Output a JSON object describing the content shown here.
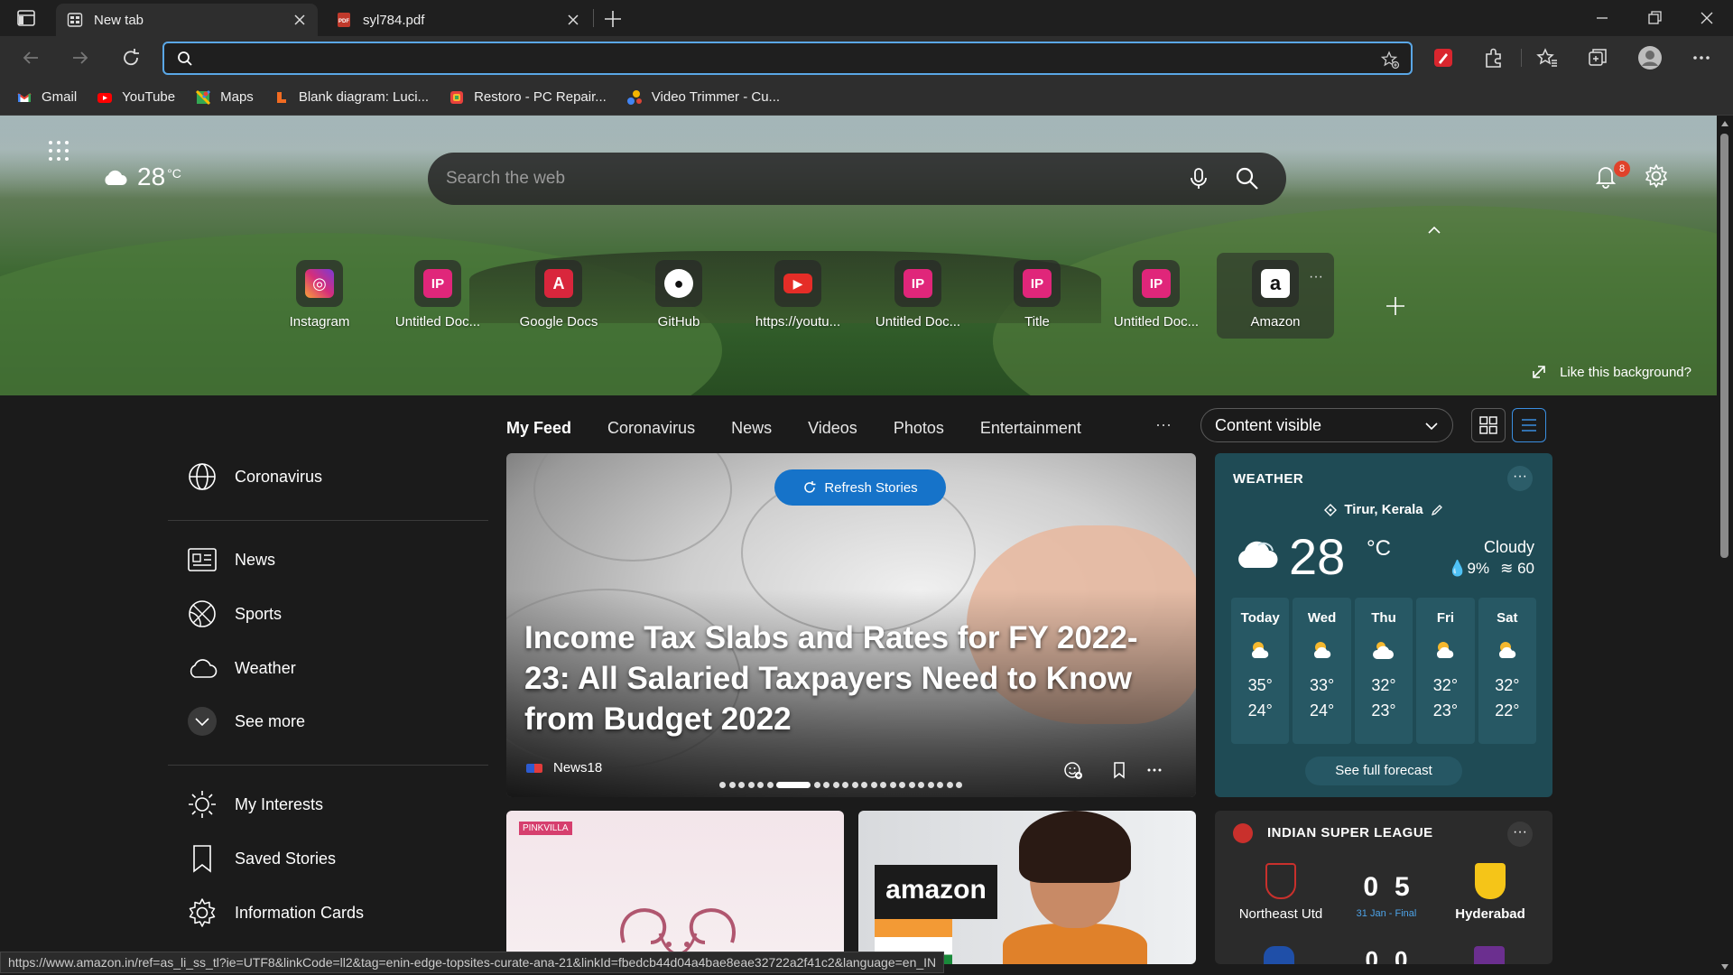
{
  "browser": {
    "tabs": [
      {
        "title": "New tab",
        "active": true
      },
      {
        "title": "syl784.pdf",
        "active": false
      }
    ],
    "address": {
      "value": "",
      "placeholder": ""
    },
    "bookmarks": [
      {
        "label": "Gmail",
        "icon": "gmail-icon"
      },
      {
        "label": "YouTube",
        "icon": "youtube-icon"
      },
      {
        "label": "Maps",
        "icon": "maps-icon"
      },
      {
        "label": "Blank diagram: Luci...",
        "icon": "lucidchart-icon"
      },
      {
        "label": "Restoro - PC Repair...",
        "icon": "restoro-icon"
      },
      {
        "label": "Video Trimmer - Cu...",
        "icon": "video-trimmer-icon"
      }
    ],
    "status_url": "https://www.amazon.in/ref=as_li_ss_tl?ie=UTF8&linkCode=ll2&tag=enin-edge-topsites-curate-ana-21&linkId=fbedcb44d04a4bae8eae32722a2f41c2&language=en_IN"
  },
  "hero": {
    "weather_temp": "28",
    "weather_unit": "°C",
    "search_placeholder": "Search the web",
    "notification_count": "8",
    "like_background": "Like this background?",
    "quick_links": [
      {
        "label": "Instagram",
        "glyph": "◎",
        "color": "#d62e7a"
      },
      {
        "label": "Untitled Doc...",
        "glyph": "IP",
        "color": "#e0267a"
      },
      {
        "label": "Google Docs",
        "glyph": "A",
        "color": "#d9263c"
      },
      {
        "label": "GitHub",
        "glyph": "●",
        "color": "#111111"
      },
      {
        "label": "https://youtu...",
        "glyph": "▶",
        "color": "#e52d27"
      },
      {
        "label": "Untitled Doc...",
        "glyph": "IP",
        "color": "#e0267a"
      },
      {
        "label": "Title",
        "glyph": "IP",
        "color": "#e0267a"
      },
      {
        "label": "Untitled Doc...",
        "glyph": "IP",
        "color": "#e0267a"
      },
      {
        "label": "Amazon",
        "glyph": "a",
        "color": "#ffffff"
      }
    ]
  },
  "left_nav": {
    "items": [
      {
        "label": "Coronavirus",
        "icon": "globe-icon"
      },
      {
        "label": "News",
        "icon": "newspaper-icon"
      },
      {
        "label": "Sports",
        "icon": "basketball-icon"
      },
      {
        "label": "Weather",
        "icon": "cloud-icon"
      },
      {
        "label": "See more",
        "icon": "chevron-down-icon"
      },
      {
        "label": "My Interests",
        "icon": "sun-icon"
      },
      {
        "label": "Saved Stories",
        "icon": "bookmark-icon"
      },
      {
        "label": "Information Cards",
        "icon": "gear-icon"
      }
    ]
  },
  "feed": {
    "tabs": [
      "My Feed",
      "Coronavirus",
      "News",
      "Videos",
      "Photos",
      "Entertainment"
    ],
    "more": "···",
    "content_select": "Content visible",
    "refresh_label": "Refresh Stories",
    "headline": "Income Tax Slabs and Rates for FY 2022-23: All Salaried Taxpayers Need to Know from Budget 2022",
    "source": "News18",
    "carousel_count": 23,
    "carousel_active": 6
  },
  "weather": {
    "title": "WEATHER",
    "location": "Tirur, Kerala",
    "temp": "28",
    "unit": "°C",
    "condition": "Cloudy",
    "precip": "9%",
    "aqi": "60",
    "forecast": [
      {
        "day": "Today",
        "hi": "35°",
        "lo": "24°"
      },
      {
        "day": "Wed",
        "hi": "33°",
        "lo": "24°"
      },
      {
        "day": "Thu",
        "hi": "32°",
        "lo": "23°"
      },
      {
        "day": "Fri",
        "hi": "32°",
        "lo": "23°"
      },
      {
        "day": "Sat",
        "hi": "32°",
        "lo": "22°"
      }
    ],
    "full_forecast": "See full forecast"
  },
  "cards": {
    "pinkvilla_tag": "PINKVILLA",
    "amazon_text": "amazon"
  },
  "isl": {
    "title": "INDIAN SUPER LEAGUE",
    "home_team": "Northeast Utd",
    "away_team": "Hyderabad",
    "home_score": "0",
    "away_score": "5",
    "date": "31 Jan - Final",
    "next_home_score": "0",
    "next_away_score": "0"
  },
  "colors": {
    "accent": "#1673c9",
    "weather_card": "#1f4b55",
    "notification_badge": "#e0422a"
  }
}
